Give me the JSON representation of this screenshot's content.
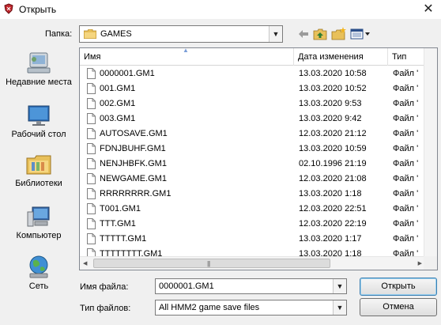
{
  "window": {
    "title": "Открыть",
    "close_glyph": "✕",
    "app_icon": "shield-app-icon"
  },
  "folder": {
    "label": "Папка:",
    "value": "GAMES",
    "icons": [
      "back-arrow-icon",
      "up-folder-icon",
      "new-folder-icon",
      "view-menu-icon"
    ]
  },
  "places": [
    {
      "label": "Недавние места",
      "icon": "recent-places-icon"
    },
    {
      "label": "Рабочий стол",
      "icon": "desktop-icon"
    },
    {
      "label": "Библиотеки",
      "icon": "libraries-icon"
    },
    {
      "label": "Компьютер",
      "icon": "computer-icon"
    },
    {
      "label": "Сеть",
      "icon": "network-icon"
    }
  ],
  "columns": {
    "name": "Имя",
    "date": "Дата изменения",
    "type": "Тип"
  },
  "files": [
    {
      "name": "0000001.GM1",
      "date": "13.03.2020 10:58",
      "type": "Файл '"
    },
    {
      "name": "001.GM1",
      "date": "13.03.2020 10:52",
      "type": "Файл '"
    },
    {
      "name": "002.GM1",
      "date": "13.03.2020 9:53",
      "type": "Файл '"
    },
    {
      "name": "003.GM1",
      "date": "13.03.2020 9:42",
      "type": "Файл '"
    },
    {
      "name": "AUTOSAVE.GM1",
      "date": "12.03.2020 21:12",
      "type": "Файл '"
    },
    {
      "name": "FDNJBUHF.GM1",
      "date": "13.03.2020 10:59",
      "type": "Файл '"
    },
    {
      "name": "NENJHBFK.GM1",
      "date": "02.10.1996 21:19",
      "type": "Файл '"
    },
    {
      "name": "NEWGAME.GM1",
      "date": "12.03.2020 21:08",
      "type": "Файл '"
    },
    {
      "name": "RRRRRRRR.GM1",
      "date": "13.03.2020 1:18",
      "type": "Файл '"
    },
    {
      "name": "T001.GM1",
      "date": "12.03.2020 22:51",
      "type": "Файл '"
    },
    {
      "name": "TTT.GM1",
      "date": "12.03.2020 22:19",
      "type": "Файл '"
    },
    {
      "name": "TTTTT.GM1",
      "date": "13.03.2020 1:17",
      "type": "Файл '"
    },
    {
      "name": "TTTTTTTT.GM1",
      "date": "13.03.2020 1:18",
      "type": "Файл '"
    }
  ],
  "filename": {
    "label": "Имя файла:",
    "value": "0000001.GM1"
  },
  "filetype": {
    "label": "Тип файлов:",
    "value": "All HMM2 game save files"
  },
  "buttons": {
    "open": "Открыть",
    "cancel": "Отмена"
  },
  "colors": {
    "accent": "#3c7fb1",
    "folder_yellow": "#e8c05a"
  }
}
